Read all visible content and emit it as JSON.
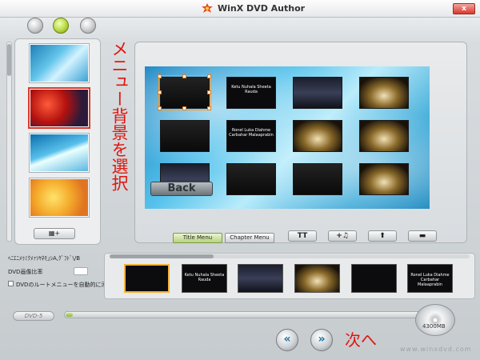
{
  "window": {
    "title": "WinX DVD Author",
    "close_label": "x"
  },
  "annotations": {
    "vertical": "メニュー背景を選択",
    "next": "次へ"
  },
  "backgrounds": {
    "add_button_label": "▦+"
  },
  "preview": {
    "back_label": "Back",
    "menu_items": [
      {
        "kind": "selected",
        "text": ""
      },
      {
        "kind": "text",
        "text": "Ketu Nuhala Sheeta Rauda"
      },
      {
        "kind": "scene",
        "text": ""
      },
      {
        "kind": "stage",
        "text": ""
      },
      {
        "kind": "dark",
        "text": ""
      },
      {
        "kind": "text",
        "text": "Ronel Luka Diahme Carbahar Malaaprabin"
      },
      {
        "kind": "stage",
        "text": ""
      },
      {
        "kind": "stage",
        "text": ""
      },
      {
        "kind": "scene",
        "text": ""
      },
      {
        "kind": "dark",
        "text": ""
      },
      {
        "kind": "dark",
        "text": ""
      },
      {
        "kind": "stage",
        "text": ""
      }
    ]
  },
  "tabs": {
    "title_menu": "Title Menu",
    "chapter_menu": "Chapter Menu"
  },
  "tools": {
    "text": "TT",
    "add_music": "+♫",
    "move_up": "⬆",
    "remove": "▬"
  },
  "settings": {
    "garbled_label": "ﾍﾆｴﾆﾒｩﾐｸﾒｧｿﾔﾈﾓ｣ｼA,ｸﾞﾌﾄﾞ\\/B",
    "aspect_label": "DVD画像比率",
    "root_menu_label": "DVDのルートメニューを自動的に添加する"
  },
  "chapters": [
    {
      "kind": "selected",
      "text": ""
    },
    {
      "kind": "text",
      "text": "Ketu Nuhala Sheeta Rauda"
    },
    {
      "kind": "scene",
      "text": ""
    },
    {
      "kind": "stage",
      "text": ""
    },
    {
      "kind": "dark",
      "text": ""
    },
    {
      "kind": "text",
      "text": "Ronel Luka Diahme Carbahar Malaaprabin"
    }
  ],
  "footer": {
    "dvd_label": "DVD-5",
    "disc_capacity": "4300MB",
    "capacity_used_fraction": 0.02,
    "prev": "«",
    "next": "»",
    "watermark": "www.winxdvd.com"
  }
}
